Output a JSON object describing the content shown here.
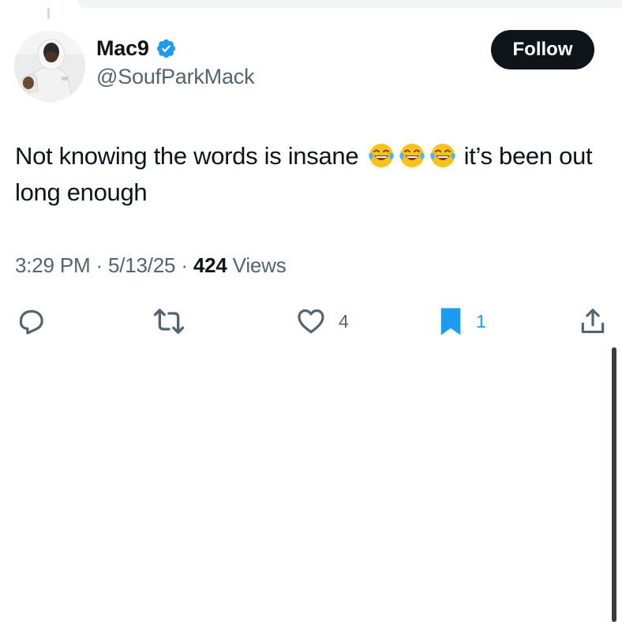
{
  "author": {
    "display_name": "Mac9",
    "handle": "@SoufParkMack",
    "verified": true,
    "avatar_icon": "profile-photo"
  },
  "follow_label": "Follow",
  "tweet": {
    "text_before": "Not knowing the words is insane",
    "emojis": [
      "😂",
      "😂",
      "😂"
    ],
    "text_after": "it’s been out long enough"
  },
  "meta": {
    "time": "3:29 PM",
    "sep1": "·",
    "date": "5/13/25",
    "sep2": "·",
    "views_count": "424",
    "views_label": "Views"
  },
  "actions": {
    "reply_icon": "reply-icon",
    "retweet_icon": "retweet-icon",
    "like_icon": "heart-icon",
    "like_count": "4",
    "bookmark_icon": "bookmark-icon",
    "bookmark_count": "1",
    "share_icon": "share-icon"
  },
  "colors": {
    "text": "#0f1419",
    "secondary": "#536471",
    "accent": "#1d9bf0",
    "button_bg": "#0f1419"
  }
}
